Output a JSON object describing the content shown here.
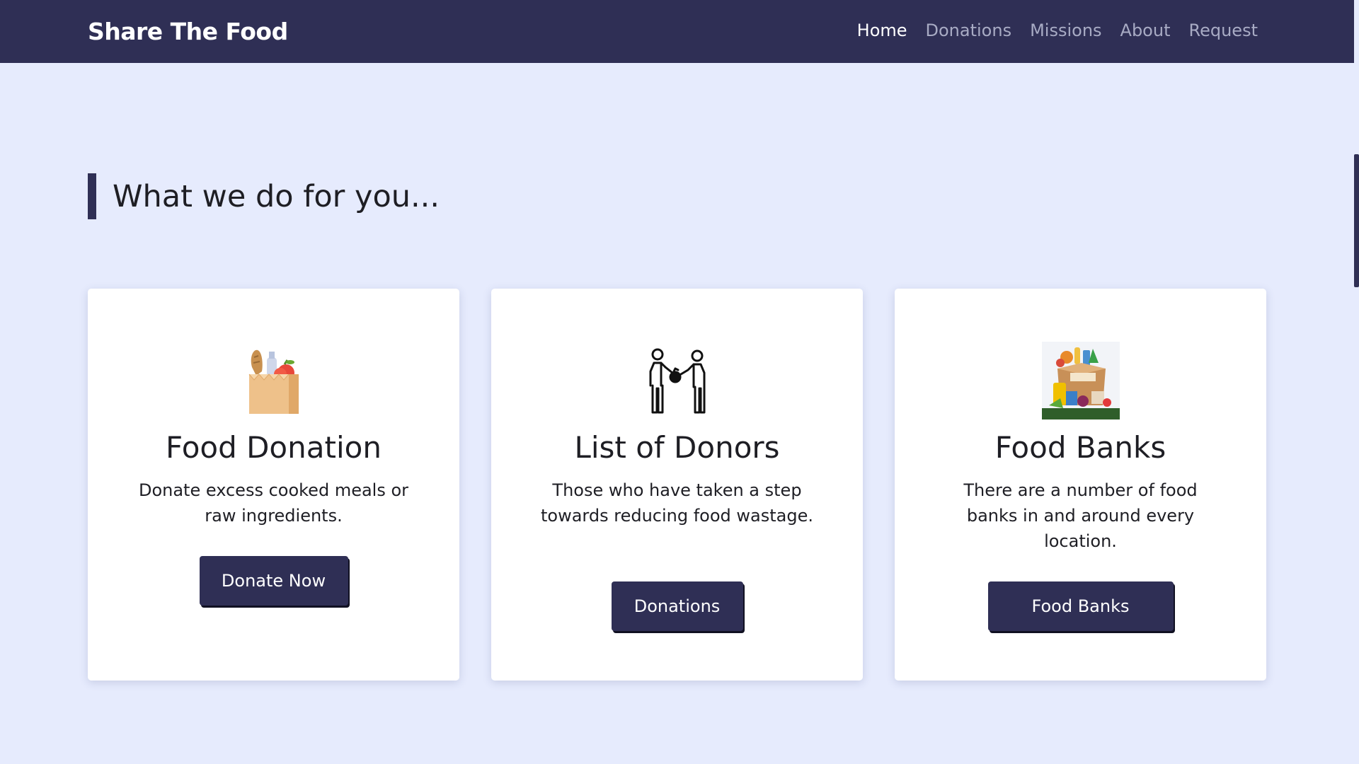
{
  "navbar": {
    "brand": "Share The Food",
    "links": [
      {
        "label": "Home",
        "active": true
      },
      {
        "label": "Donations",
        "active": false
      },
      {
        "label": "Missions",
        "active": false
      },
      {
        "label": "About",
        "active": false
      },
      {
        "label": "Request",
        "active": false
      }
    ]
  },
  "section": {
    "title": "What we do for you..."
  },
  "cards": [
    {
      "icon": "grocery-bag-icon",
      "title": "Food Donation",
      "description": "Donate excess cooked meals or raw ingredients.",
      "button_label": "Donate Now"
    },
    {
      "icon": "donors-handing-food-icon",
      "title": "List of Donors",
      "description": "Those who have taken a step towards reducing food wastage.",
      "button_label": "Donations"
    },
    {
      "icon": "food-bank-box-icon",
      "title": "Food Banks",
      "description": "There are a number of food banks in and around every location.",
      "button_label": "Food Banks"
    }
  ],
  "colors": {
    "navbar_bg": "#2f2f55",
    "page_bg": "#e6ebfd",
    "button_bg": "#2f2f55",
    "card_bg": "#ffffff"
  }
}
